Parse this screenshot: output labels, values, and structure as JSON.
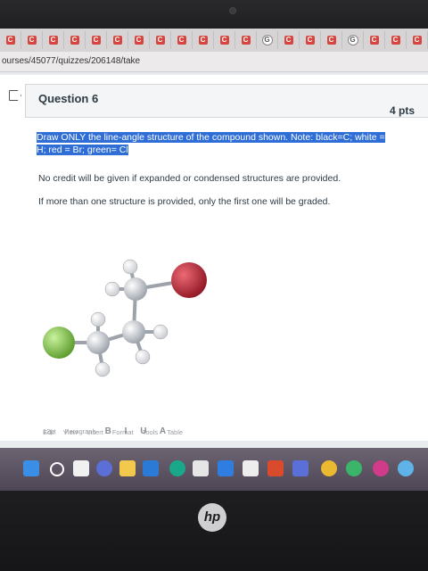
{
  "browser": {
    "tabs": [
      "C",
      "C",
      "C",
      "C",
      "C",
      "C",
      "C",
      "C",
      "C",
      "C",
      "C",
      "C",
      "G",
      "C",
      "C",
      "C",
      "G",
      "C",
      "C",
      "C"
    ],
    "url": "ourses/45077/quizzes/206148/take"
  },
  "question": {
    "title": "Question 6",
    "points": "4 pts",
    "instruction_line1": "Draw ONLY the line-angle structure of the compound shown.  Note: black=C; white =",
    "instruction_line2": "H; red = Br; green= Cl",
    "paragraph1": "No credit will be given if expanded or condensed structures are provided.",
    "paragraph2": "If more than one structure is provided, only the first one will be graded."
  },
  "editor": {
    "menu": [
      "Edit",
      "View",
      "Insert",
      "Format",
      "Tools",
      "Table"
    ],
    "font_size": "12pt",
    "paragraph": "Paragraph",
    "format_buttons": "B I U A"
  },
  "device": {
    "brand": "hp"
  },
  "colors": {
    "accent_highlight": "#2f6ed6",
    "carbon": "#c9ccd3",
    "bromine": "#c0283a",
    "chlorine": "#7bc04a",
    "hydrogen": "#ffffff"
  }
}
